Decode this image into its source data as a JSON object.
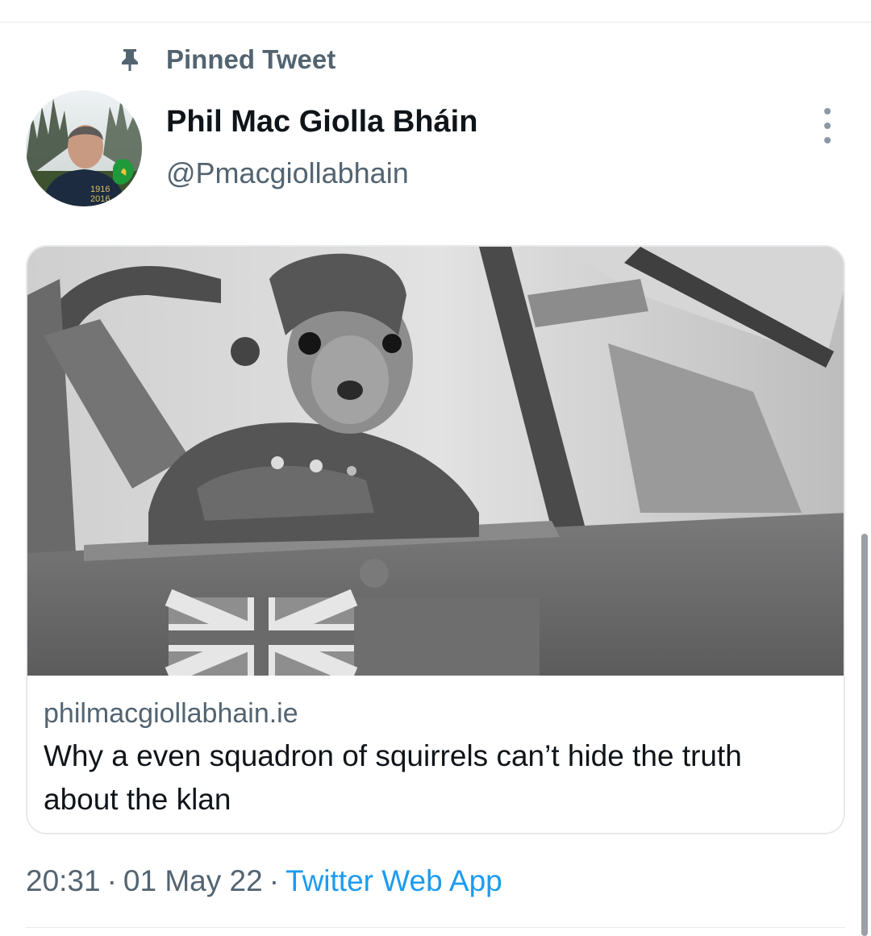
{
  "pinned": {
    "label": "Pinned Tweet",
    "icon": "pin-icon"
  },
  "author": {
    "display_name": "Phil Mac Giolla Bháin",
    "handle": "@Pmacgiollabhain",
    "avatar_text_top": "1916",
    "avatar_text_bottom": "2016"
  },
  "card": {
    "domain": "philmacgiollabhain.ie",
    "title": "Why a even squadron of squirrels can’t hide the truth about the klan"
  },
  "meta": {
    "time": "20:31",
    "date": "01 May 22",
    "separator": "·",
    "source": "Twitter Web App"
  },
  "colors": {
    "secondary_text": "#536471",
    "link": "#1d9bf0",
    "primary_text": "#0f1419"
  }
}
